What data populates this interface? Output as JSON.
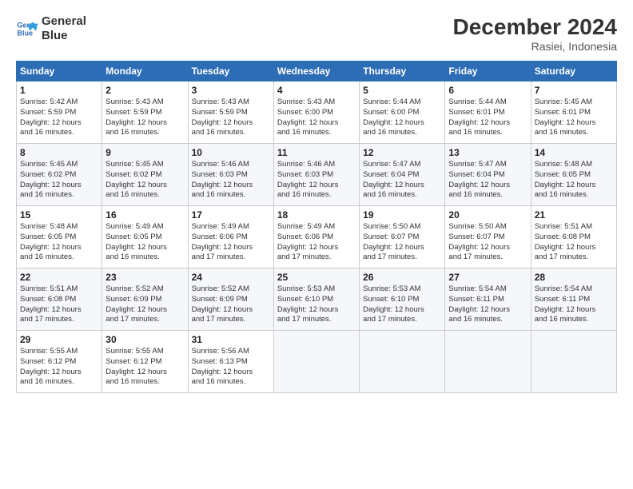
{
  "logo": {
    "line1": "General",
    "line2": "Blue"
  },
  "header": {
    "title": "December 2024",
    "location": "Rasiei, Indonesia"
  },
  "weekdays": [
    "Sunday",
    "Monday",
    "Tuesday",
    "Wednesday",
    "Thursday",
    "Friday",
    "Saturday"
  ],
  "weeks": [
    [
      {
        "day": "1",
        "info": "Sunrise: 5:42 AM\nSunset: 5:59 PM\nDaylight: 12 hours\nand 16 minutes."
      },
      {
        "day": "2",
        "info": "Sunrise: 5:43 AM\nSunset: 5:59 PM\nDaylight: 12 hours\nand 16 minutes."
      },
      {
        "day": "3",
        "info": "Sunrise: 5:43 AM\nSunset: 5:59 PM\nDaylight: 12 hours\nand 16 minutes."
      },
      {
        "day": "4",
        "info": "Sunrise: 5:43 AM\nSunset: 6:00 PM\nDaylight: 12 hours\nand 16 minutes."
      },
      {
        "day": "5",
        "info": "Sunrise: 5:44 AM\nSunset: 6:00 PM\nDaylight: 12 hours\nand 16 minutes."
      },
      {
        "day": "6",
        "info": "Sunrise: 5:44 AM\nSunset: 6:01 PM\nDaylight: 12 hours\nand 16 minutes."
      },
      {
        "day": "7",
        "info": "Sunrise: 5:45 AM\nSunset: 6:01 PM\nDaylight: 12 hours\nand 16 minutes."
      }
    ],
    [
      {
        "day": "8",
        "info": "Sunrise: 5:45 AM\nSunset: 6:02 PM\nDaylight: 12 hours\nand 16 minutes."
      },
      {
        "day": "9",
        "info": "Sunrise: 5:45 AM\nSunset: 6:02 PM\nDaylight: 12 hours\nand 16 minutes."
      },
      {
        "day": "10",
        "info": "Sunrise: 5:46 AM\nSunset: 6:03 PM\nDaylight: 12 hours\nand 16 minutes."
      },
      {
        "day": "11",
        "info": "Sunrise: 5:46 AM\nSunset: 6:03 PM\nDaylight: 12 hours\nand 16 minutes."
      },
      {
        "day": "12",
        "info": "Sunrise: 5:47 AM\nSunset: 6:04 PM\nDaylight: 12 hours\nand 16 minutes."
      },
      {
        "day": "13",
        "info": "Sunrise: 5:47 AM\nSunset: 6:04 PM\nDaylight: 12 hours\nand 16 minutes."
      },
      {
        "day": "14",
        "info": "Sunrise: 5:48 AM\nSunset: 6:05 PM\nDaylight: 12 hours\nand 16 minutes."
      }
    ],
    [
      {
        "day": "15",
        "info": "Sunrise: 5:48 AM\nSunset: 6:05 PM\nDaylight: 12 hours\nand 16 minutes."
      },
      {
        "day": "16",
        "info": "Sunrise: 5:49 AM\nSunset: 6:05 PM\nDaylight: 12 hours\nand 16 minutes."
      },
      {
        "day": "17",
        "info": "Sunrise: 5:49 AM\nSunset: 6:06 PM\nDaylight: 12 hours\nand 17 minutes."
      },
      {
        "day": "18",
        "info": "Sunrise: 5:49 AM\nSunset: 6:06 PM\nDaylight: 12 hours\nand 17 minutes."
      },
      {
        "day": "19",
        "info": "Sunrise: 5:50 AM\nSunset: 6:07 PM\nDaylight: 12 hours\nand 17 minutes."
      },
      {
        "day": "20",
        "info": "Sunrise: 5:50 AM\nSunset: 6:07 PM\nDaylight: 12 hours\nand 17 minutes."
      },
      {
        "day": "21",
        "info": "Sunrise: 5:51 AM\nSunset: 6:08 PM\nDaylight: 12 hours\nand 17 minutes."
      }
    ],
    [
      {
        "day": "22",
        "info": "Sunrise: 5:51 AM\nSunset: 6:08 PM\nDaylight: 12 hours\nand 17 minutes."
      },
      {
        "day": "23",
        "info": "Sunrise: 5:52 AM\nSunset: 6:09 PM\nDaylight: 12 hours\nand 17 minutes."
      },
      {
        "day": "24",
        "info": "Sunrise: 5:52 AM\nSunset: 6:09 PM\nDaylight: 12 hours\nand 17 minutes."
      },
      {
        "day": "25",
        "info": "Sunrise: 5:53 AM\nSunset: 6:10 PM\nDaylight: 12 hours\nand 17 minutes."
      },
      {
        "day": "26",
        "info": "Sunrise: 5:53 AM\nSunset: 6:10 PM\nDaylight: 12 hours\nand 17 minutes."
      },
      {
        "day": "27",
        "info": "Sunrise: 5:54 AM\nSunset: 6:11 PM\nDaylight: 12 hours\nand 16 minutes."
      },
      {
        "day": "28",
        "info": "Sunrise: 5:54 AM\nSunset: 6:11 PM\nDaylight: 12 hours\nand 16 minutes."
      }
    ],
    [
      {
        "day": "29",
        "info": "Sunrise: 5:55 AM\nSunset: 6:12 PM\nDaylight: 12 hours\nand 16 minutes."
      },
      {
        "day": "30",
        "info": "Sunrise: 5:55 AM\nSunset: 6:12 PM\nDaylight: 12 hours\nand 16 minutes."
      },
      {
        "day": "31",
        "info": "Sunrise: 5:56 AM\nSunset: 6:13 PM\nDaylight: 12 hours\nand 16 minutes."
      },
      {
        "day": "",
        "info": ""
      },
      {
        "day": "",
        "info": ""
      },
      {
        "day": "",
        "info": ""
      },
      {
        "day": "",
        "info": ""
      }
    ]
  ]
}
